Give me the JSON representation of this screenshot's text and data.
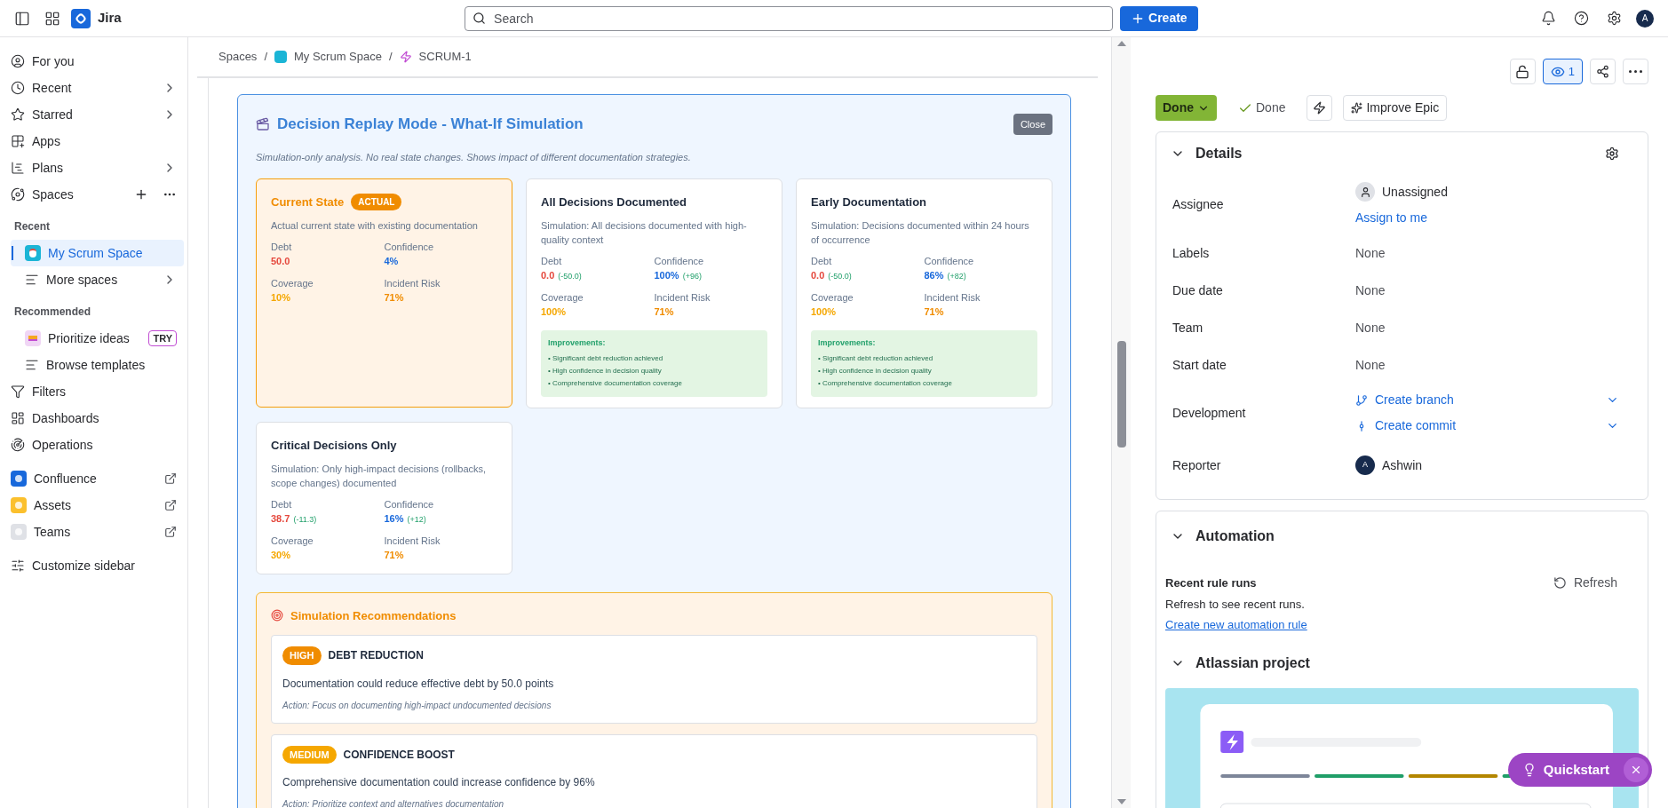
{
  "topbar": {
    "app_name": "Jira",
    "search": {
      "placeholder": "Search"
    },
    "create_button": "Create",
    "avatar": "A"
  },
  "sidebar": {
    "items": [
      {
        "kind": "link",
        "label": "For you",
        "selected": false
      },
      {
        "kind": "expandable",
        "label": "Recent",
        "selected": false
      },
      {
        "kind": "expandable",
        "label": "Starred",
        "selected": false
      },
      {
        "kind": "link",
        "label": "Apps",
        "selected": false
      },
      {
        "kind": "expandable",
        "label": "Plans",
        "selected": false
      },
      {
        "kind": "spaces",
        "label": "Spaces",
        "selected": false
      },
      {
        "kind": "heading",
        "label": "Recent"
      },
      {
        "kind": "space",
        "label": "My Scrum Space",
        "selected": true
      },
      {
        "kind": "sub-expandable",
        "label": "More spaces",
        "selected": false
      },
      {
        "kind": "heading",
        "label": "Recommended"
      },
      {
        "kind": "promo",
        "label": "Prioritize ideas",
        "badge": "TRY",
        "selected": false
      },
      {
        "kind": "sub-link",
        "label": "Browse templates",
        "selected": false
      },
      {
        "kind": "link",
        "label": "Filters",
        "selected": false
      },
      {
        "kind": "link",
        "label": "Dashboards",
        "selected": false
      },
      {
        "kind": "link",
        "label": "Operations",
        "selected": false
      },
      {
        "kind": "external",
        "label": "Confluence",
        "selected": false
      },
      {
        "kind": "external",
        "label": "Assets",
        "selected": false
      },
      {
        "kind": "external",
        "label": "Teams",
        "selected": false
      },
      {
        "kind": "link",
        "label": "Customize sidebar",
        "selected": false
      }
    ]
  },
  "breadcrumbs": [
    {
      "label": "Spaces",
      "separator": "/"
    },
    {
      "label": "My Scrum Space",
      "separator": "/"
    },
    {
      "label": "SCRUM-1"
    }
  ],
  "simulation": {
    "title": "Decision Replay Mode - What-If Simulation",
    "close_button": "Close",
    "subtitle": "Simulation-only analysis. No real state changes. Shows impact of different documentation strategies.",
    "scenarios": [
      {
        "kind": "actual",
        "title": "Current State",
        "badge": "ACTUAL",
        "description": "Actual current state with existing documentation",
        "metrics": [
          {
            "kind": "debt",
            "label": "Debt",
            "value": "50.0"
          },
          {
            "kind": "confidence",
            "label": "Confidence",
            "value": "4%"
          },
          {
            "kind": "coverage",
            "label": "Coverage",
            "value": "10%"
          },
          {
            "kind": "risk",
            "label": "Incident Risk",
            "value": "71%"
          }
        ]
      },
      {
        "kind": "simulation",
        "title": "All Decisions Documented",
        "description": "Simulation: All decisions documented with high-quality context",
        "metrics": [
          {
            "kind": "debt",
            "label": "Debt",
            "value": "0.0",
            "delta": "(-50.0)"
          },
          {
            "kind": "confidence",
            "label": "Confidence",
            "value": "100%",
            "delta": "(+96)"
          },
          {
            "kind": "coverage",
            "label": "Coverage",
            "value": "100%"
          },
          {
            "kind": "risk",
            "label": "Incident Risk",
            "value": "71%"
          }
        ],
        "improvements": {
          "title": "Improvements:",
          "items": [
            "• Significant debt reduction achieved",
            "• High confidence in decision quality",
            "• Comprehensive documentation coverage"
          ]
        }
      },
      {
        "kind": "simulation",
        "title": "Early Documentation",
        "description": "Simulation: Decisions documented within 24 hours of occurrence",
        "metrics": [
          {
            "kind": "debt",
            "label": "Debt",
            "value": "0.0",
            "delta": "(-50.0)"
          },
          {
            "kind": "confidence",
            "label": "Confidence",
            "value": "86%",
            "delta": "(+82)"
          },
          {
            "kind": "coverage",
            "label": "Coverage",
            "value": "100%"
          },
          {
            "kind": "risk",
            "label": "Incident Risk",
            "value": "71%"
          }
        ],
        "improvements": {
          "title": "Improvements:",
          "items": [
            "• Significant debt reduction achieved",
            "• High confidence in decision quality",
            "• Comprehensive documentation coverage"
          ]
        }
      },
      {
        "kind": "simulation",
        "title": "Critical Decisions Only",
        "description": "Simulation: Only high-impact decisions (rollbacks, scope changes) documented",
        "metrics": [
          {
            "kind": "debt",
            "label": "Debt",
            "value": "38.7",
            "delta": "(-11.3)"
          },
          {
            "kind": "confidence",
            "label": "Confidence",
            "value": "16%",
            "delta": "(+12)"
          },
          {
            "kind": "coverage",
            "label": "Coverage",
            "value": "30%"
          },
          {
            "kind": "risk",
            "label": "Incident Risk",
            "value": "71%"
          }
        ]
      }
    ],
    "recommendations": {
      "title": "Simulation Recommendations",
      "items": [
        {
          "kind": "high",
          "priority": "HIGH",
          "title": "DEBT REDUCTION",
          "text": "Documentation could reduce effective debt by 50.0 points",
          "action": "Action: Focus on documenting high-impact undocumented decisions"
        },
        {
          "kind": "medium",
          "priority": "MEDIUM",
          "title": "CONFIDENCE BOOST",
          "text": "Comprehensive documentation could increase confidence by 96%",
          "action": "Action: Prioritize context and alternatives documentation"
        }
      ]
    }
  },
  "issue_panel": {
    "watchers": "1",
    "status_button": "Done",
    "resolution": "Done",
    "improve_button": "Improve Epic",
    "details": {
      "title": "Details",
      "fields": [
        {
          "kind": "user",
          "label": "Assignee",
          "value": "Unassigned",
          "link": "Assign to me"
        },
        {
          "kind": "text",
          "label": "Labels",
          "value": "None"
        },
        {
          "kind": "text",
          "label": "Due date",
          "value": "None"
        },
        {
          "kind": "text",
          "label": "Team",
          "value": "None"
        },
        {
          "kind": "text",
          "label": "Start date",
          "value": "None"
        },
        {
          "kind": "development",
          "label": "Development",
          "actions": [
            "Create branch",
            "Create commit"
          ]
        },
        {
          "kind": "reporter",
          "label": "Reporter",
          "value": "Ashwin",
          "avatar": "A"
        }
      ]
    },
    "automation": {
      "title": "Automation",
      "recent_title": "Recent rule runs",
      "refresh_button": "Refresh",
      "empty_text": "Refresh to see recent runs.",
      "create_link": "Create new automation rule",
      "project_title": "Atlassian project"
    },
    "quickstart_button": "Quickstart"
  }
}
